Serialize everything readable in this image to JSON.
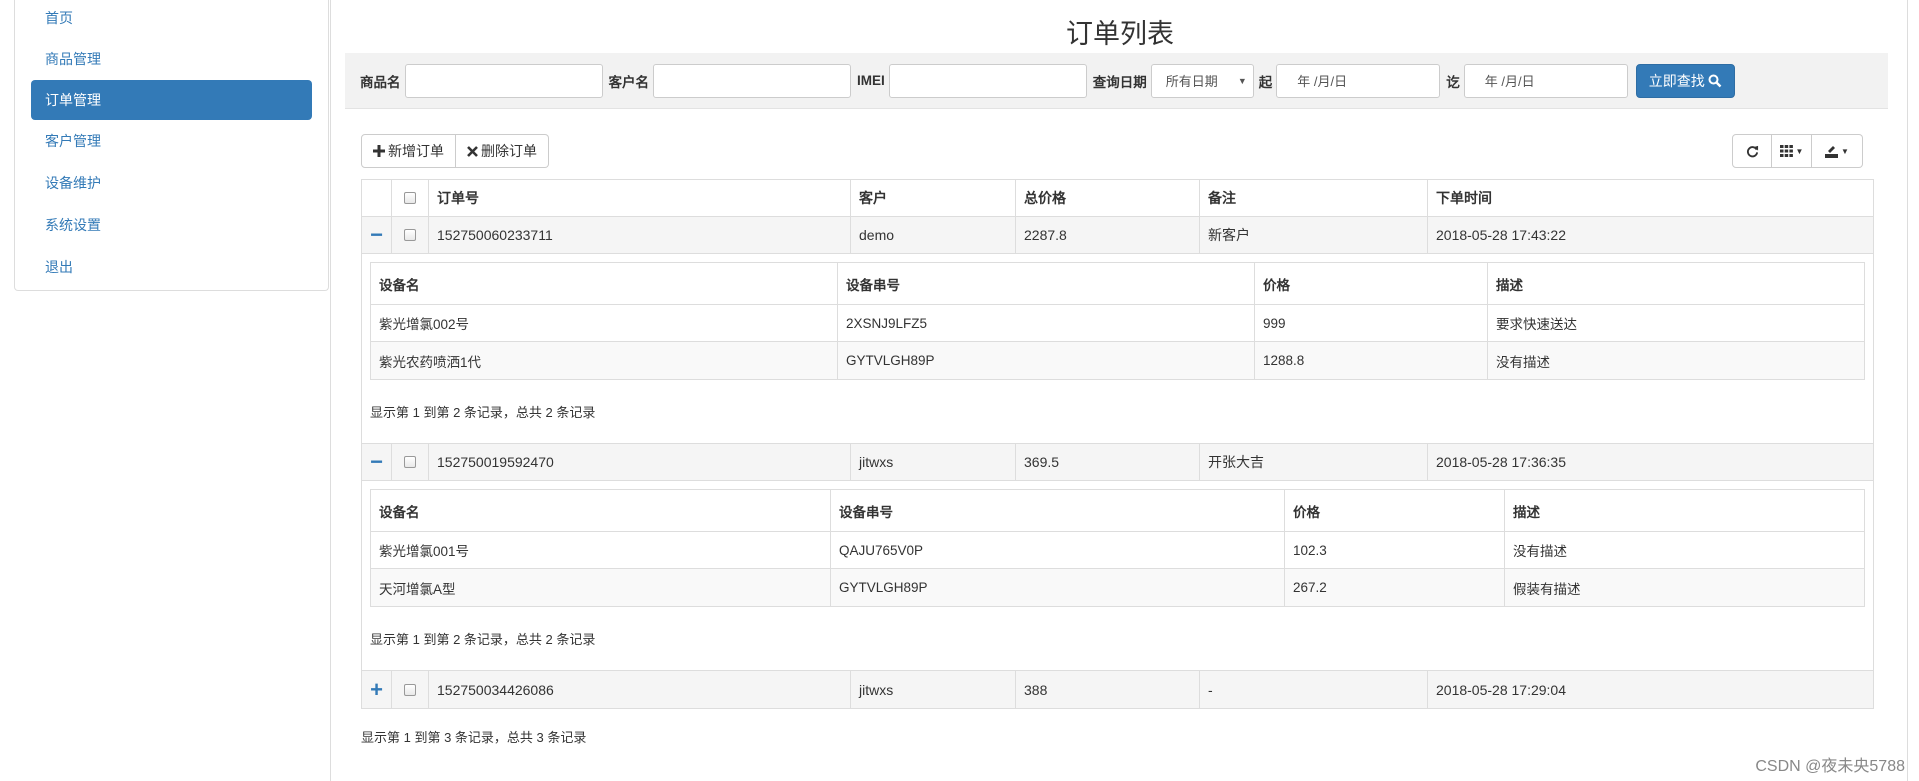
{
  "sidebar": {
    "items": [
      {
        "label": "首页"
      },
      {
        "label": "商品管理"
      },
      {
        "label": "订单管理"
      },
      {
        "label": "客户管理"
      },
      {
        "label": "设备维护"
      },
      {
        "label": "系统设置"
      },
      {
        "label": "退出"
      }
    ]
  },
  "page": {
    "title": "订单列表"
  },
  "search": {
    "product_label": "商品名",
    "customer_label": "客户名",
    "imei_label": "IMEI",
    "date_label": "查询日期",
    "date_select_value": "所有日期",
    "from_label": "起",
    "from_placeholder": "年 /月/日",
    "to_label": "讫",
    "to_placeholder": "年 /月/日",
    "search_button": "立即查找"
  },
  "toolbar": {
    "add_label": "新增订单",
    "delete_label": "删除订单"
  },
  "table": {
    "headers": {
      "id": "订单号",
      "customer": "客户",
      "total": "总价格",
      "note": "备注",
      "time": "下单时间"
    },
    "sub_headers": {
      "name": "设备名",
      "serial": "设备串号",
      "price": "价格",
      "desc": "描述"
    },
    "orders": [
      {
        "toggle": "−",
        "id": "152750060233711",
        "customer": "demo",
        "total": "2287.8",
        "note": "新客户",
        "time": "2018-05-28 17:43:22",
        "devices": [
          {
            "name": "紫光增氯002号",
            "serial": "2XSNJ9LFZ5",
            "price": "999",
            "desc": "要求快速送达"
          },
          {
            "name": "紫光农药喷洒1代",
            "serial": "GYTVLGH89P",
            "price": "1288.8",
            "desc": "没有描述"
          }
        ],
        "sub_footer": "显示第 1 到第 2 条记录，总共 2 条记录"
      },
      {
        "toggle": "−",
        "id": "152750019592470",
        "customer": "jitwxs",
        "total": "369.5",
        "note": "开张大吉",
        "time": "2018-05-28 17:36:35",
        "devices": [
          {
            "name": "紫光增氯001号",
            "serial": "QAJU765V0P",
            "price": "102.3",
            "desc": "没有描述"
          },
          {
            "name": "天河增氯A型",
            "serial": "GYTVLGH89P",
            "price": "267.2",
            "desc": "假装有描述"
          }
        ],
        "sub_footer": "显示第 1 到第 2 条记录，总共 2 条记录"
      },
      {
        "toggle": "+",
        "id": "152750034426086",
        "customer": "jitwxs",
        "total": "388",
        "note": "-",
        "time": "2018-05-28 17:29:04"
      }
    ],
    "footer": "显示第 1 到第 3 条记录，总共 3 条记录"
  },
  "watermark": "CSDN @夜未央5788"
}
